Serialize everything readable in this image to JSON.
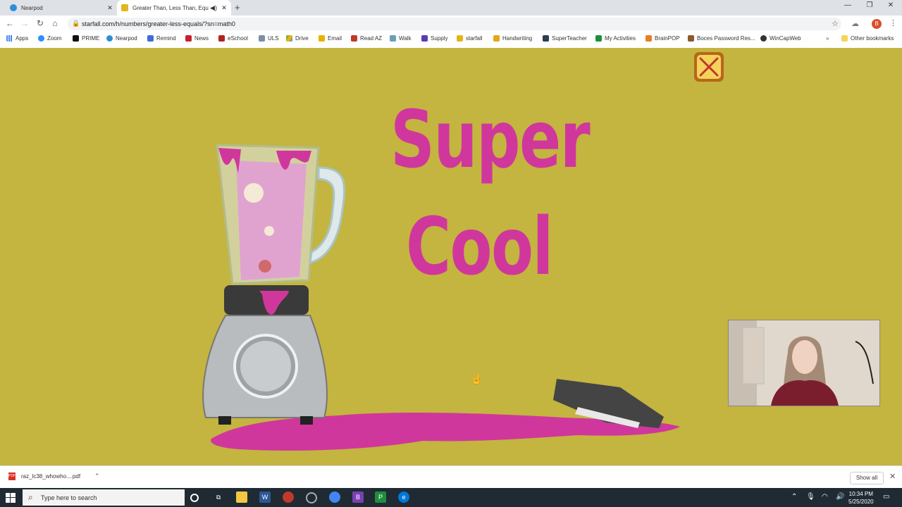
{
  "browser": {
    "tabs": [
      {
        "title": "Nearpod",
        "icon": "nearpod-icon",
        "active": false
      },
      {
        "title": "Greater Than, Less Than, Equ",
        "icon": "starfall-icon",
        "active": true
      }
    ],
    "url": "starfall.com/h/numbers/greater-less-equals/?sn=math0",
    "profile_initial": "B",
    "bookmarks": [
      {
        "label": "Apps",
        "icon": "apps-icon",
        "color": "#4285f4"
      },
      {
        "label": "Zoom",
        "icon": "zoom-icon",
        "color": "#2d8cff"
      },
      {
        "label": "PRIME",
        "icon": "amazon-icon",
        "color": "#111111"
      },
      {
        "label": "Nearpod",
        "icon": "nearpod-icon",
        "color": "#2a8fd8"
      },
      {
        "label": "Remind",
        "icon": "remind-icon",
        "color": "#3b6ed8"
      },
      {
        "label": "News",
        "icon": "news-icon",
        "color": "#c8202f"
      },
      {
        "label": "eSchool",
        "icon": "eschool-icon",
        "color": "#b22222"
      },
      {
        "label": "ULS",
        "icon": "uls-icon",
        "color": "#7a8fa8"
      },
      {
        "label": "Drive",
        "icon": "drive-icon",
        "color": "#34a853"
      },
      {
        "label": "Email",
        "icon": "email-icon",
        "color": "#e8b100"
      },
      {
        "label": "Read AZ",
        "icon": "readaz-icon",
        "color": "#c0392b"
      },
      {
        "label": "Walk",
        "icon": "walk-icon",
        "color": "#6a9fb5"
      },
      {
        "label": "Supply",
        "icon": "supply-icon",
        "color": "#5b3db0"
      },
      {
        "label": "starfall",
        "icon": "starfall-icon",
        "color": "#e3b51c"
      },
      {
        "label": "Handwriting",
        "icon": "handwriting-icon",
        "color": "#e0a81a"
      },
      {
        "label": "SuperTeacher",
        "icon": "superteacher-icon",
        "color": "#2c3e50"
      },
      {
        "label": "My Activities",
        "icon": "activities-icon",
        "color": "#1e8e3e"
      },
      {
        "label": "BrainPOP",
        "icon": "brainpop-icon",
        "color": "#e67e22"
      },
      {
        "label": "Boces Password Res...",
        "icon": "boces-icon",
        "color": "#8a5a2b"
      },
      {
        "label": "WinCapWeb",
        "icon": "wincap-icon",
        "color": "#333333"
      }
    ],
    "other_bookmarks": "Other bookmarks"
  },
  "game": {
    "line1": "Super",
    "line2": "Cool",
    "accent_color": "#d0379c",
    "background_color": "#c4b440"
  },
  "downloads": {
    "file_name": "raz_lc38_whowho....pdf",
    "pdf_badge": "PDF",
    "show_all": "Show all"
  },
  "taskbar": {
    "search_placeholder": "Type here to search",
    "time": "10:34 PM",
    "date": "5/25/2020"
  }
}
